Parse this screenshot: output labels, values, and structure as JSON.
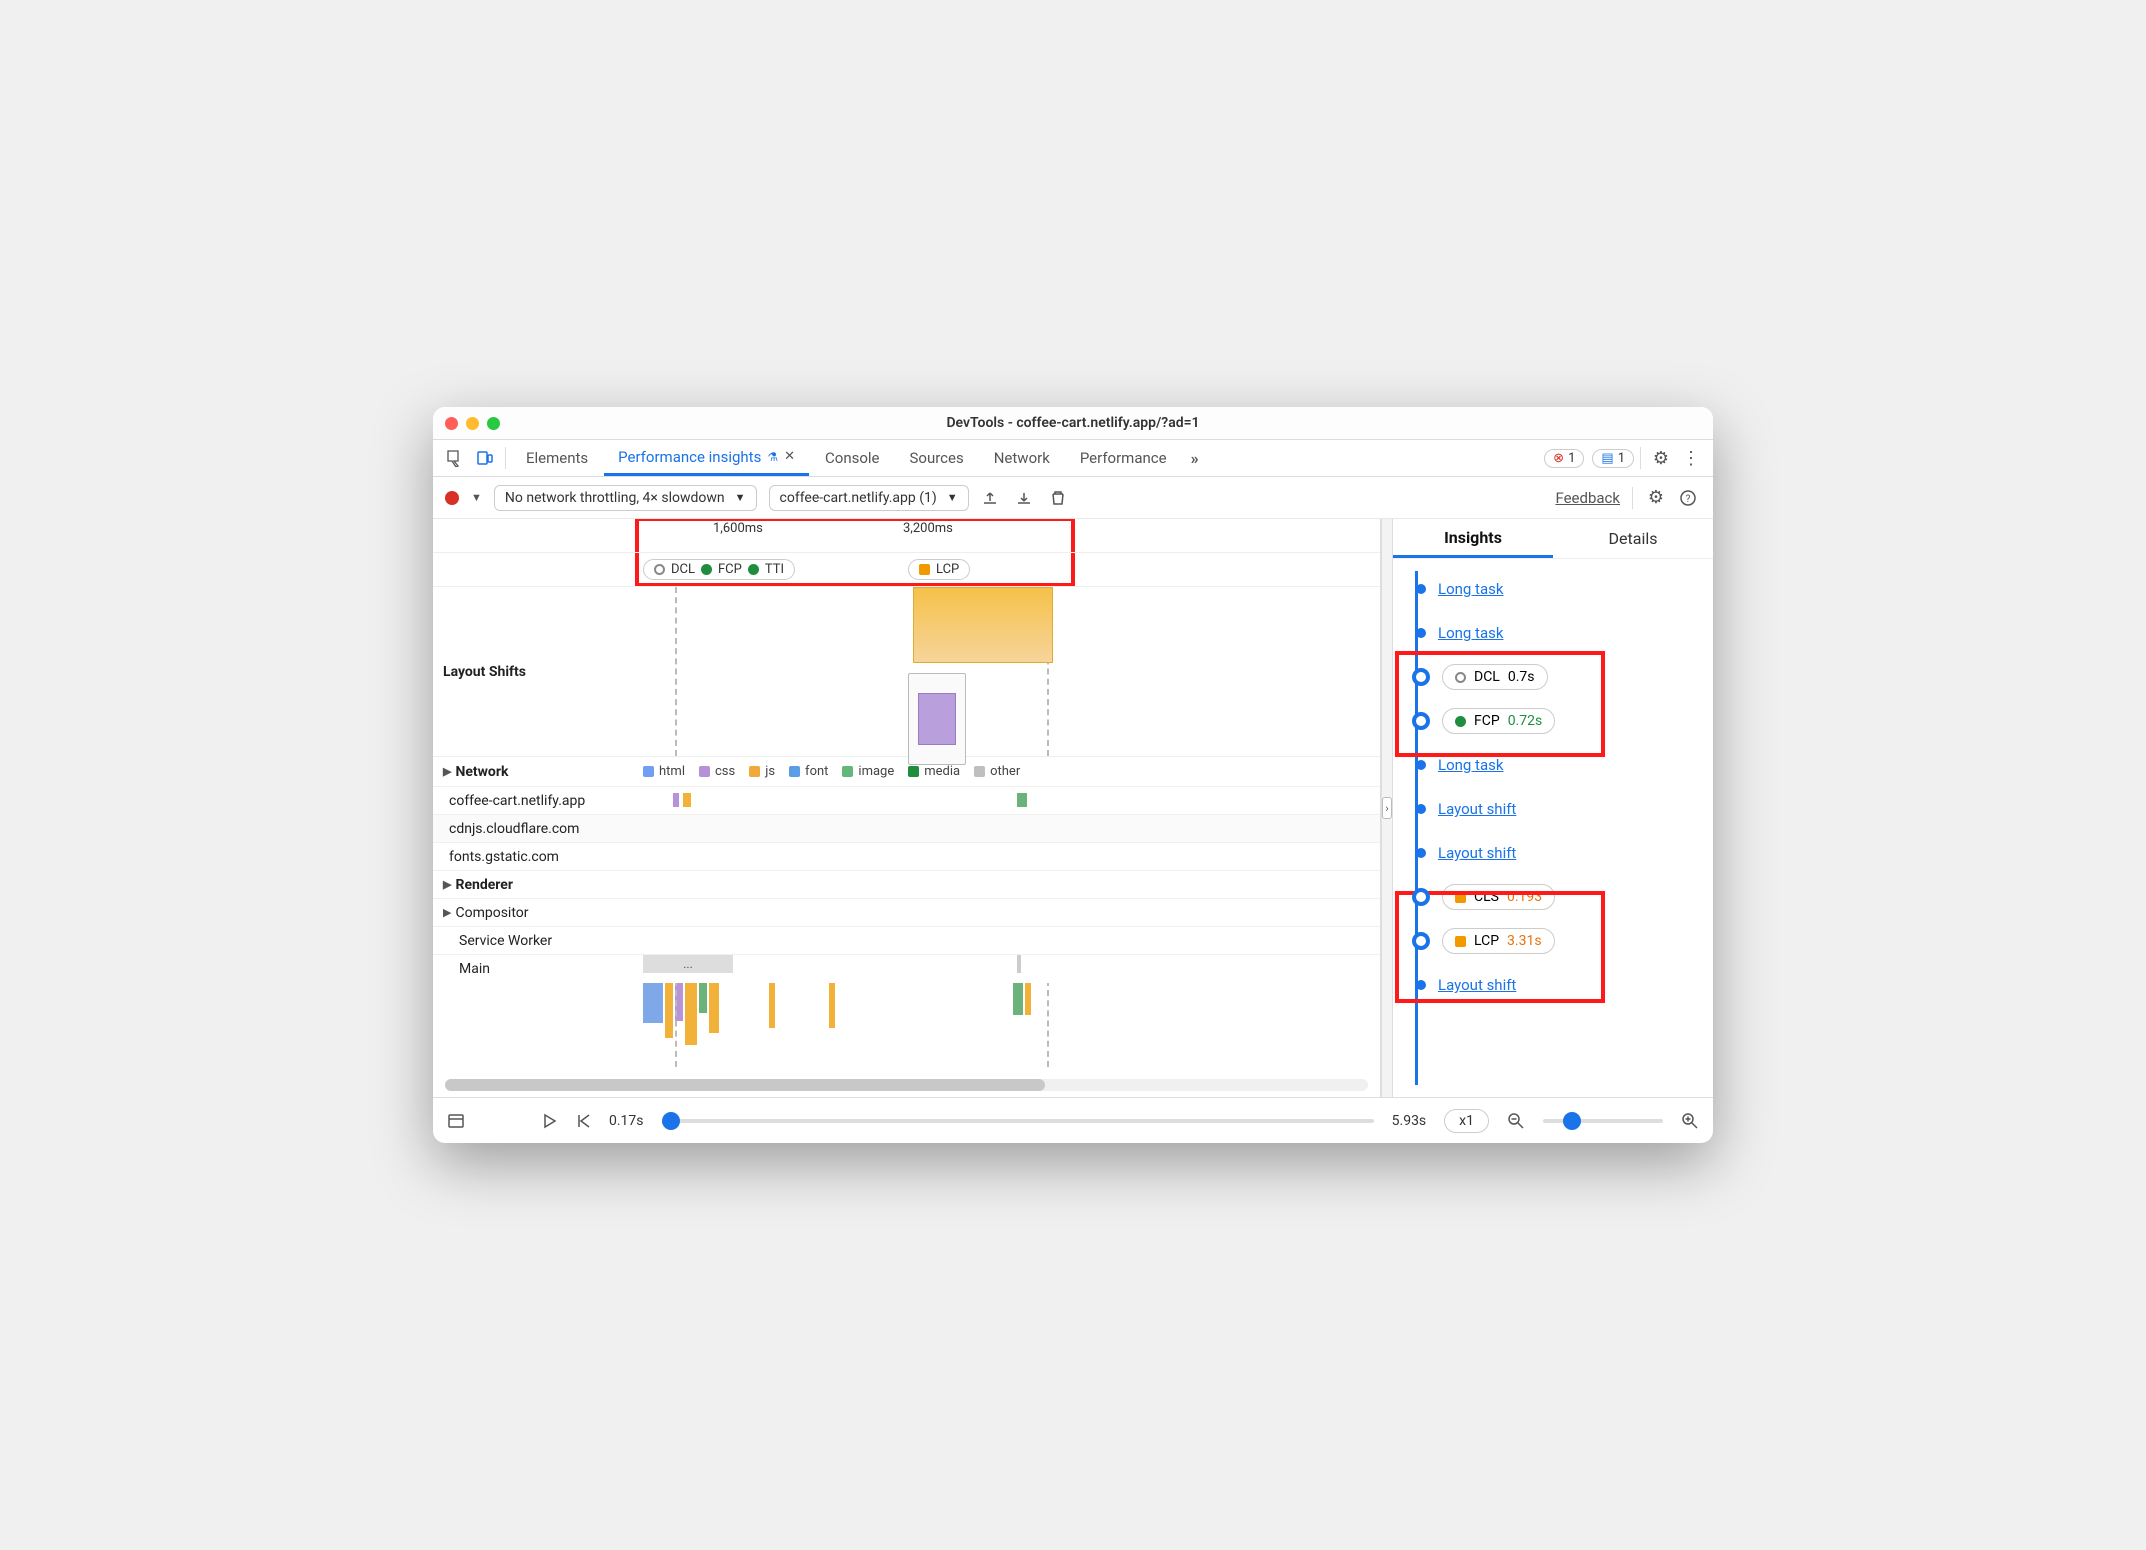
{
  "window_title": "DevTools - coffee-cart.netlify.app/?ad=1",
  "tabs": {
    "items": [
      "Elements",
      "Performance insights",
      "Console",
      "Sources",
      "Network",
      "Performance"
    ],
    "active_index": 1,
    "more_indicator": "»",
    "error_count": "1",
    "message_count": "1"
  },
  "toolbar": {
    "throttling": "No network throttling, 4× slowdown",
    "page_select": "coffee-cart.netlify.app (1)",
    "feedback": "Feedback"
  },
  "timeline": {
    "ticks": [
      "1,600ms",
      "3,200ms"
    ],
    "markers_left": [
      "DCL",
      "FCP",
      "TTI"
    ],
    "markers_right": [
      "LCP"
    ],
    "marker_colors": {
      "DCL": "ring",
      "FCP": "#1e8e3e",
      "TTI": "#1e8e3e",
      "LCP": "#f29900"
    }
  },
  "sections": {
    "layout_shifts": "Layout Shifts",
    "network": "Network",
    "network_legend": [
      {
        "label": "html",
        "color": "#6f9ef3"
      },
      {
        "label": "css",
        "color": "#b392d8"
      },
      {
        "label": "js",
        "color": "#f2a93b"
      },
      {
        "label": "font",
        "color": "#5a9de6"
      },
      {
        "label": "image",
        "color": "#64b77a"
      },
      {
        "label": "media",
        "color": "#1e8e3e"
      },
      {
        "label": "other",
        "color": "#bfbfbf"
      }
    ],
    "hosts": [
      "coffee-cart.netlify.app",
      "cdnjs.cloudflare.com",
      "fonts.gstatic.com"
    ],
    "renderer": "Renderer",
    "renderer_rows": [
      "Compositor",
      "Service Worker",
      "Main"
    ]
  },
  "insights": {
    "tabs": [
      "Insights",
      "Details"
    ],
    "active": 0,
    "items": [
      {
        "kind": "link",
        "label": "Long task"
      },
      {
        "kind": "link",
        "label": "Long task"
      },
      {
        "kind": "pill",
        "icon": "ring",
        "name": "DCL",
        "value": "0.7s",
        "value_class": ""
      },
      {
        "kind": "pill",
        "icon": "dot",
        "icon_color": "#1e8e3e",
        "name": "FCP",
        "value": "0.72s",
        "value_class": "val-green"
      },
      {
        "kind": "link",
        "label": "Long task"
      },
      {
        "kind": "link",
        "label": "Layout shift"
      },
      {
        "kind": "link",
        "label": "Layout shift"
      },
      {
        "kind": "pill",
        "icon": "sq",
        "icon_color": "#f29900",
        "name": "CLS",
        "value": "0.193",
        "value_class": "val-amber"
      },
      {
        "kind": "pill",
        "icon": "sq",
        "icon_color": "#f29900",
        "name": "LCP",
        "value": "3.31s",
        "value_class": "val-amber"
      },
      {
        "kind": "link",
        "label": "Layout shift"
      }
    ]
  },
  "footer": {
    "start": "0.17s",
    "end": "5.93s",
    "speed": "x1"
  }
}
